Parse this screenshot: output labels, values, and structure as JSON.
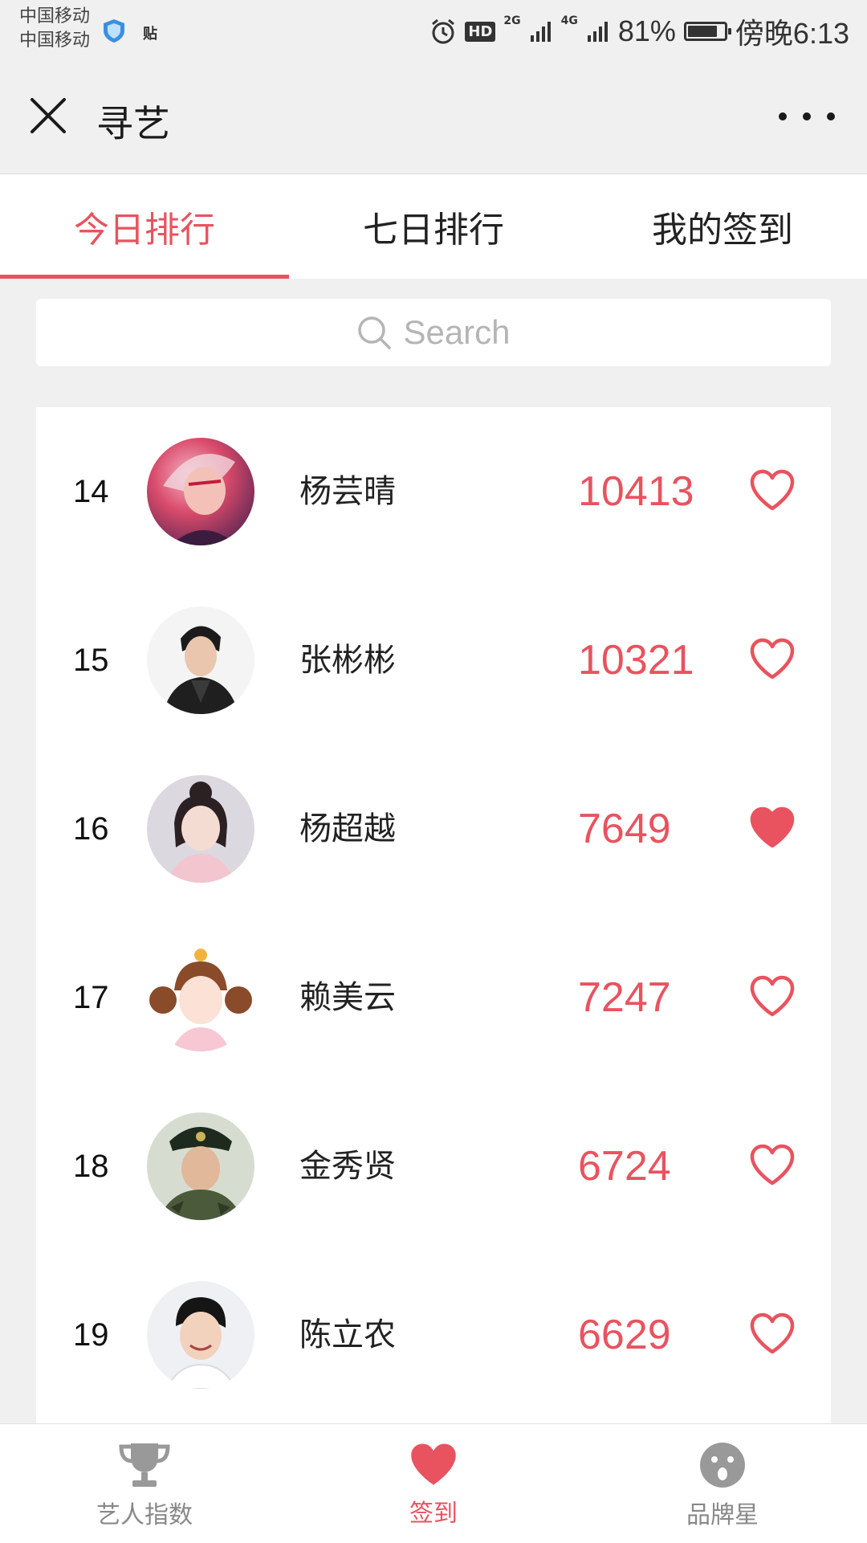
{
  "status_bar": {
    "carrier1": "中国移动",
    "carrier2": "中国移动",
    "extra_icon_text": "贴",
    "hd": "HD",
    "net1": "2G",
    "net2": "4G",
    "battery": "81%",
    "battery_level": 0.81,
    "time": "傍晚6:13"
  },
  "header": {
    "title": "寻艺"
  },
  "tabs": [
    {
      "label": "今日排行",
      "active": true
    },
    {
      "label": "七日排行",
      "active": false
    },
    {
      "label": "我的签到",
      "active": false
    }
  ],
  "search": {
    "placeholder": "Search"
  },
  "ranking": [
    {
      "rank": "14",
      "name": "杨芸晴",
      "score": "10413",
      "liked": false
    },
    {
      "rank": "15",
      "name": "张彬彬",
      "score": "10321",
      "liked": false
    },
    {
      "rank": "16",
      "name": "杨超越",
      "score": "7649",
      "liked": true
    },
    {
      "rank": "17",
      "name": "赖美云",
      "score": "7247",
      "liked": false
    },
    {
      "rank": "18",
      "name": "金秀贤",
      "score": "6724",
      "liked": false
    },
    {
      "rank": "19",
      "name": "陈立农",
      "score": "6629",
      "liked": false
    }
  ],
  "bottom_nav": [
    {
      "label": "艺人指数",
      "icon": "trophy-icon",
      "active": false
    },
    {
      "label": "签到",
      "icon": "heart-icon",
      "active": true
    },
    {
      "label": "品牌星",
      "icon": "face-icon",
      "active": false
    }
  ],
  "colors": {
    "accent": "#e8535f",
    "background": "#f0f0f0",
    "inactive": "#888888"
  }
}
